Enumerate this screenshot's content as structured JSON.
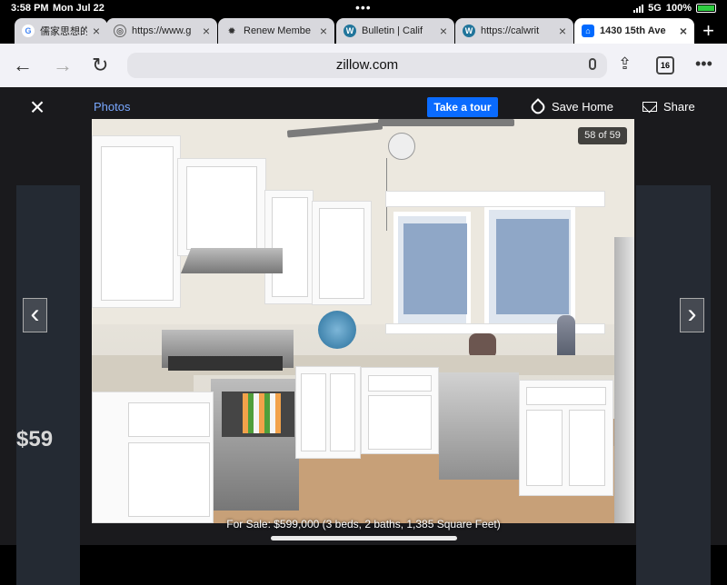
{
  "status": {
    "time": "3:58 PM",
    "date": "Mon Jul 22",
    "signal": "5G",
    "battery": "100%"
  },
  "tabs": [
    {
      "label": "儒家思想的",
      "icon": "google-icon",
      "color": "#4285f4"
    },
    {
      "label": "https://www.g",
      "icon": "globe-icon",
      "color": "#666666"
    },
    {
      "label": "Renew Membe",
      "icon": "crab-icon",
      "color": "#333333"
    },
    {
      "label": "Bulletin | Calif",
      "icon": "wordpress-icon",
      "color": "#21759b"
    },
    {
      "label": "https://calwrit",
      "icon": "wordpress-icon",
      "color": "#21759b"
    },
    {
      "label": "1430 15th Ave",
      "icon": "zillow-icon",
      "color": "#006aff"
    }
  ],
  "address": {
    "url": "zillow.com",
    "tab_count": "16"
  },
  "viewer": {
    "photos_label": "Photos",
    "tour_label": "Take a tour",
    "save_label": "Save Home",
    "share_label": "Share",
    "counter": "58 of 59",
    "caption": "For Sale: $599,000 (3 beds, 2 baths, 1,385 Square Feet)",
    "background_price": "$59"
  }
}
